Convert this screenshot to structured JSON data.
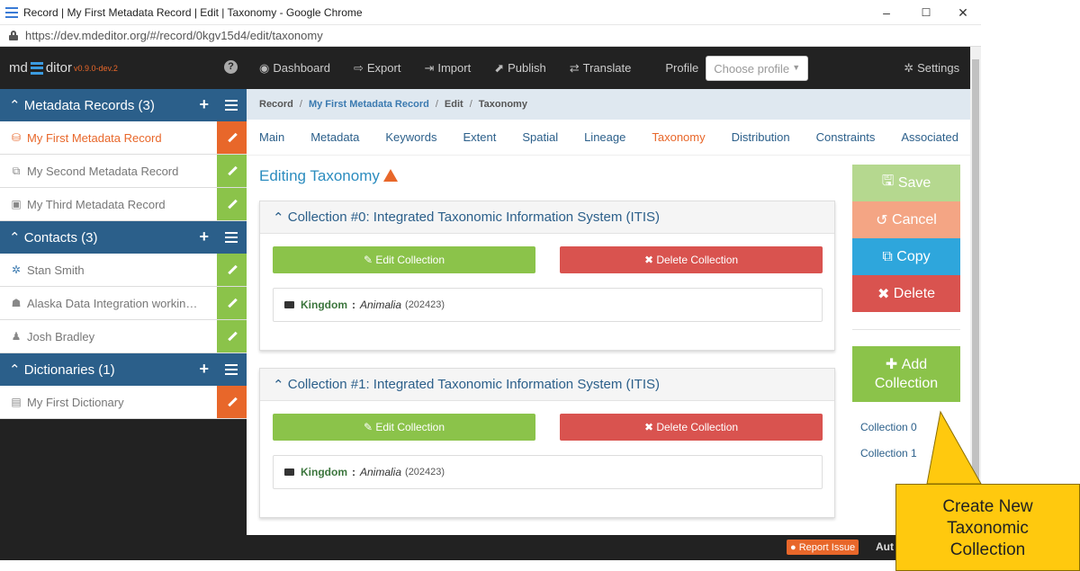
{
  "window": {
    "title": "Record | My First Metadata Record | Edit | Taxonomy - Google Chrome",
    "url": "https://dev.mdeditor.org/#/record/0kgv15d4/edit/taxonomy",
    "min": "–",
    "max": "☐",
    "close": "✕"
  },
  "app": {
    "logo_md": "md",
    "logo_rest": "ditor",
    "version": "v0.9.0-dev.2",
    "help": "?"
  },
  "sidebar": {
    "sections": [
      {
        "label": "Metadata Records (3)",
        "items": [
          {
            "label": "My First Metadata Record",
            "icon": "database-icon",
            "active": true
          },
          {
            "label": "My Second Metadata Record",
            "icon": "copy-icon"
          },
          {
            "label": "My Third Metadata Record",
            "icon": "image-icon"
          }
        ]
      },
      {
        "label": "Contacts (3)",
        "items": [
          {
            "label": "Stan Smith",
            "icon": "person-icon"
          },
          {
            "label": "Alaska Data Integration working...",
            "icon": "group-icon"
          },
          {
            "label": "Josh Bradley",
            "icon": "user-icon"
          }
        ]
      },
      {
        "label": "Dictionaries (1)",
        "items": [
          {
            "label": "My First Dictionary",
            "icon": "book-icon"
          }
        ]
      }
    ]
  },
  "topnav": {
    "dashboard": "Dashboard",
    "export": "Export",
    "import": "Import",
    "publish": "Publish",
    "translate": "Translate",
    "profile": "Profile",
    "profile_placeholder": "Choose profile",
    "settings": "Settings"
  },
  "breadcrumb": {
    "record": "Record",
    "name": "My First Metadata Record",
    "edit": "Edit",
    "taxonomy": "Taxonomy",
    "sep": "/"
  },
  "tabs": [
    "Main",
    "Metadata",
    "Keywords",
    "Extent",
    "Spatial",
    "Lineage",
    "Taxonomy",
    "Distribution",
    "Constraints",
    "Associated"
  ],
  "active_tab": "Taxonomy",
  "main": {
    "title": "Editing Taxonomy",
    "collections": [
      {
        "title": "Collection #0: Integrated Taxonomic Information System (ITIS)",
        "edit": "Edit Collection",
        "delete": "Delete Collection",
        "rank": "Kingdom",
        "value": "Animalia",
        "tsn": "(202423)"
      },
      {
        "title": "Collection #1: Integrated Taxonomic Information System (ITIS)",
        "edit": "Edit Collection",
        "delete": "Delete Collection",
        "rank": "Kingdom",
        "value": "Animalia",
        "tsn": "(202423)"
      }
    ]
  },
  "actions": {
    "save": "Save",
    "cancel": "Cancel",
    "copy": "Copy",
    "delete": "Delete",
    "add_1": "Add",
    "add_2": "Collection",
    "link0": "Collection 0",
    "link1": "Collection 1"
  },
  "footer": {
    "report": "Report Issue",
    "auto": "Aut"
  },
  "callout": {
    "line1": "Create New",
    "line2": "Taxonomic",
    "line3": "Collection"
  },
  "colors": {
    "green": "#8bc34a",
    "red": "#d9534f",
    "orange": "#e8672a",
    "blue": "#2b5f8a",
    "callout": "#ffc90e"
  }
}
